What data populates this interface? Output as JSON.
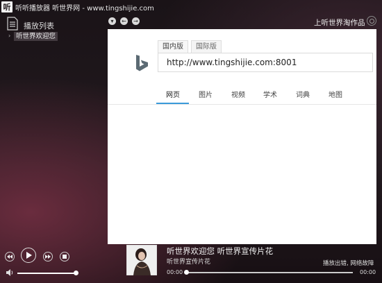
{
  "window": {
    "logo_char": "听",
    "title": "听听播放器 听世界网 - www.tingshijie.com"
  },
  "playlist": {
    "title": "播放列表",
    "items": [
      {
        "label": "听世界欢迎您"
      }
    ]
  },
  "nav": {
    "down_glyph": "▾",
    "back_glyph": "←",
    "forward_glyph": "→"
  },
  "brand": {
    "label": "上听世界淘作品"
  },
  "browser": {
    "tabs": [
      {
        "label": "国内版",
        "active": true
      },
      {
        "label": "国际版",
        "active": false
      }
    ],
    "search": {
      "value": "http://www.tingshijie.com:8001"
    },
    "scopes": [
      {
        "label": "网页",
        "active": true
      },
      {
        "label": "图片"
      },
      {
        "label": "视频"
      },
      {
        "label": "学术"
      },
      {
        "label": "词典"
      },
      {
        "label": "地图"
      }
    ]
  },
  "player": {
    "song_title": "听世界欢迎您   听世界宣传片花",
    "song_subtitle": "听世界宣传片花",
    "status": "播放出错, 网络故障",
    "time_current": "00:00",
    "time_total": "00:00",
    "progress": 0,
    "volume": 1.0
  },
  "colors": {
    "accent": "#3a9ad9",
    "background": "#1c1418",
    "bing_logo": "#5b6a73"
  },
  "icons": {
    "playlist": "playlist-icon",
    "bing": "bing-logo",
    "rewind": "rewind-icon",
    "play": "play-icon",
    "fast_forward": "fast-forward-icon",
    "stop": "stop-icon",
    "volume": "volume-icon"
  }
}
